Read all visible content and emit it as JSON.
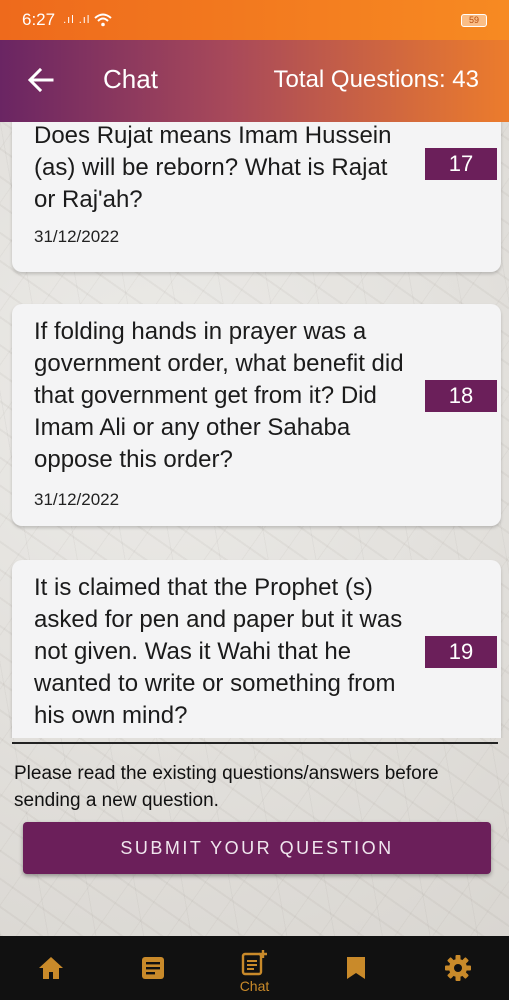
{
  "status_bar": {
    "time": "6:27",
    "signal": ".ıl .ıl",
    "battery": "59"
  },
  "app_bar": {
    "title": "Chat",
    "total_questions": "Total Questions: 43"
  },
  "questions": [
    {
      "text": "Does Rujat means Imam Hussein (as) will be reborn? What is Rajat or Raj'ah?",
      "date": "31/12/2022",
      "number": "17"
    },
    {
      "text": "If folding hands in prayer was a government order, what benefit did that government get from it? Did Imam Ali or any other Sahaba oppose this order?",
      "date": "31/12/2022",
      "number": "18"
    },
    {
      "text": "It is claimed that the Prophet (s) asked for pen and paper but it was not given. Was it Wahi that he wanted to write or something from his own mind?",
      "date": "",
      "number": "19"
    }
  ],
  "notice": "Please read the existing questions/answers before sending a new question.",
  "submit_label": "SUBMIT YOUR QUESTION",
  "bottom_nav": {
    "items": [
      {
        "icon": "home-icon",
        "label": ""
      },
      {
        "icon": "article-icon",
        "label": ""
      },
      {
        "icon": "chat-add-icon",
        "label": "Chat"
      },
      {
        "icon": "bookmark-icon",
        "label": ""
      },
      {
        "icon": "settings-icon",
        "label": ""
      }
    ]
  },
  "colors": {
    "accent": "#6b1f5a",
    "status_bar": "#f78a22",
    "nav_icon": "#c98a2a"
  }
}
